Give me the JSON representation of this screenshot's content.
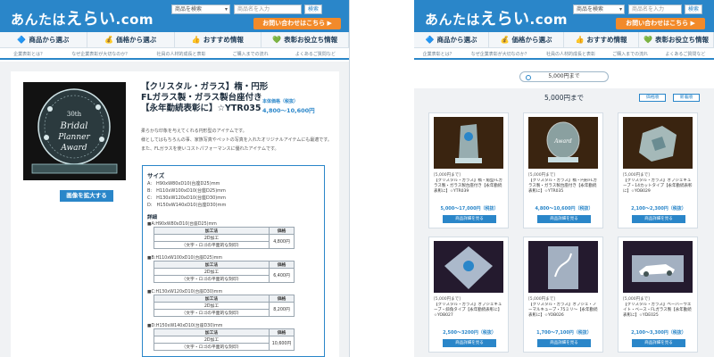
{
  "header": {
    "logo_prefix": "あんたは",
    "logo_big": "えらい",
    "logo_suffix": ".com",
    "category_select": "商品を検索",
    "search_placeholder": "商品名を入力",
    "search_button": "検索",
    "contact_button": "お問い合わせはこちら ▶"
  },
  "nav": [
    {
      "label": "商品から選ぶ",
      "icon": "🔷"
    },
    {
      "label": "価格から選ぶ",
      "icon": "💰"
    },
    {
      "label": "おすすめ情報",
      "icon": "👍"
    },
    {
      "label": "表彰お役立ち情報",
      "icon": "💚"
    }
  ],
  "subnav": [
    "企業表彰とは？",
    "なぜ企業表彰が大切なのか？",
    "社員の人材的成長と表彰",
    "ご購入までの流れ",
    "よくあるご質問など"
  ],
  "detail": {
    "title_line1": "【クリスタル・ガラス】楕・円形",
    "title_line2": "FLガラス製・ガラス製台座付き",
    "title_line3": "【永年勤続表彰に】☆YTR035",
    "price_label": "本体価格（税抜）",
    "price": "4,800〜10,600円",
    "desc1": "柔らかな印象を与えてくれる円形型のアイテムです。",
    "desc2": "様としてはもちろんの事、家族写真やペットの写真を入れたオリジナルアイテムにも最適です。",
    "desc3": "また、FLガラスを使いコストパフォーマンスに優れたアイテムです。",
    "zoom_button": "画像を拡大する",
    "spec_heading": "サイズ",
    "sizes": [
      "A:　H90xW80xD10(台座D25)mm",
      "B:　H110xW100xD10(台座D25)mm",
      "C:　H130xW120xD10(台座D30)mm",
      "D:　H150xW140xD10(台座D30)mm"
    ],
    "detail_heading": "詳細",
    "price_tables": [
      {
        "label": "■A:H90xW80xD10(台座D25)mm",
        "col1": "加工法",
        "col2": "価格",
        "method1": "2D加工",
        "method2": "（文字・ロゴの平面的な刻印）",
        "price": "4,800円"
      },
      {
        "label": "■B:H110xW100xD10(台座D25)mm",
        "col1": "加工法",
        "col2": "価格",
        "method1": "2D加工",
        "method2": "（文字・ロゴの平面的な刻印）",
        "price": "6,400円"
      },
      {
        "label": "■C:H130xW120xD10(台座D30)mm",
        "col1": "加工法",
        "col2": "価格",
        "method1": "2D加工",
        "method2": "（文字・ロゴの平面的な刻印）",
        "price": "8,200円"
      },
      {
        "label": "■D:H150xW140xD10(台座D30)mm",
        "col1": "加工法",
        "col2": "価格",
        "method1": "2D加工",
        "method2": "（文字・ロゴの平面的な刻印）",
        "price": "10,600円"
      }
    ]
  },
  "listing": {
    "pill": "5,000円まで",
    "title": "5,000円まで",
    "sort_price": "価格順",
    "sort_new": "新着順",
    "items": [
      {
        "tag": "[5,000円まで]",
        "name": "【クリスタル・ガラス】楕・角型FLガラス製・ガラス製台座付き【永年勤続表彰に】☆YTR039",
        "price": "5,000〜17,000円（税抜）",
        "button": "商品詳細を見る"
      },
      {
        "tag": "[5,000円まで]",
        "name": "【クリスタル・ガラス】楕・円形FLガラス製・ガラス製台座付き【永年勤続表彰に】☆YTR035",
        "price": "4,800〜10,600円（税抜）",
        "button": "商品詳細を見る"
      },
      {
        "tag": "[5,000円まで]",
        "name": "【クリスタル・ガラス】オブジェキューブ・14カットタイプ【永年勤続表彰に】☆YOB029",
        "price": "2,100〜2,300円（税抜）",
        "button": "商品詳細を見る"
      },
      {
        "tag": "[5,000円まで]",
        "name": "【クリスタル・ガラス】オブジェキューブ・斜角タイプ【永年勤続表彰に】☆YOB027",
        "price": "2,500〜3200円（税抜）",
        "button": "商品詳細を見る"
      },
      {
        "tag": "[5,000円まで]",
        "name": "【クリスタル・ガラス】オブジェ・ノーマルキューブ・75ミリ〜【永年勤続表彰に】☆YOB026",
        "price": "1,700〜7,100円（税抜）",
        "button": "商品詳細を見る"
      },
      {
        "tag": "[5,000円まで]",
        "name": "【クリスタル・ガラス】ペーパーウエイト・ベース・FLガラス製【永年勤続表彰に】☆YDE025",
        "price": "2,100〜3,300円（税抜）",
        "button": "商品詳細を見る"
      }
    ]
  },
  "colors": {
    "brand": "#2a86c9",
    "accent": "#f28a2a"
  }
}
